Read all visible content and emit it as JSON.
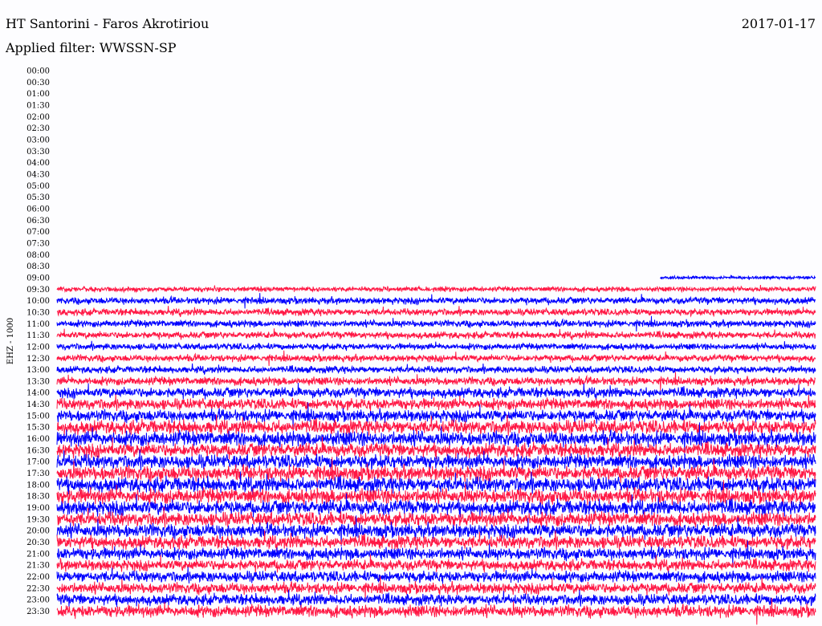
{
  "header": {
    "station": "HT Santorini - Faros Akrotiriou",
    "filter_text": "Applied filter: WWSSN-SP",
    "date": "2017-01-17"
  },
  "colors": {
    "background": "#fdfdff",
    "trace_a": "#ff1744",
    "trace_b": "#0000ff",
    "text": "#000000"
  },
  "chart_data": {
    "type": "line",
    "title": "HT Santorini - Faros Akrotiriou",
    "subtitle": "Applied filter: WWSSN-SP",
    "date": "2017-01-17",
    "ylabel": "EHZ - 1000",
    "grid": false,
    "row_interval_minutes": 30,
    "rows": [
      "00:00",
      "00:30",
      "01:00",
      "01:30",
      "02:00",
      "02:30",
      "03:00",
      "03:30",
      "04:00",
      "04:30",
      "05:00",
      "05:30",
      "06:00",
      "06:30",
      "07:00",
      "07:30",
      "08:00",
      "08:30",
      "09:00",
      "09:30",
      "10:00",
      "10:30",
      "11:00",
      "11:30",
      "12:00",
      "12:30",
      "13:00",
      "13:30",
      "14:00",
      "14:30",
      "15:00",
      "15:30",
      "16:00",
      "16:30",
      "17:00",
      "17:30",
      "18:00",
      "18:30",
      "19:00",
      "19:30",
      "20:00",
      "20:30",
      "21:00",
      "21:30",
      "22:00",
      "22:30",
      "23:00",
      "23:30"
    ],
    "trace_colors_alternating": [
      "#0000ff",
      "#ff1744"
    ],
    "data_start": {
      "row": "09:00",
      "fraction_of_row": 0.795
    },
    "amplitude_by_row": {
      "09:00": 0.35,
      "09:30": 0.55,
      "10:00": 0.75,
      "10:30": 0.75,
      "11:00": 0.75,
      "11:30": 0.75,
      "12:00": 0.7,
      "12:30": 0.75,
      "13:00": 0.75,
      "13:30": 0.9,
      "14:00": 1.1,
      "14:30": 1.2,
      "15:00": 1.3,
      "15:30": 1.5,
      "16:00": 1.6,
      "16:30": 1.5,
      "17:00": 1.5,
      "17:30": 1.6,
      "18:00": 1.6,
      "18:30": 1.6,
      "19:00": 1.6,
      "19:30": 1.5,
      "20:00": 1.5,
      "20:30": 1.4,
      "21:00": 1.3,
      "21:30": 1.2,
      "22:00": 1.2,
      "22:30": 1.2,
      "23:00": 1.2,
      "23:30": 1.3
    }
  }
}
